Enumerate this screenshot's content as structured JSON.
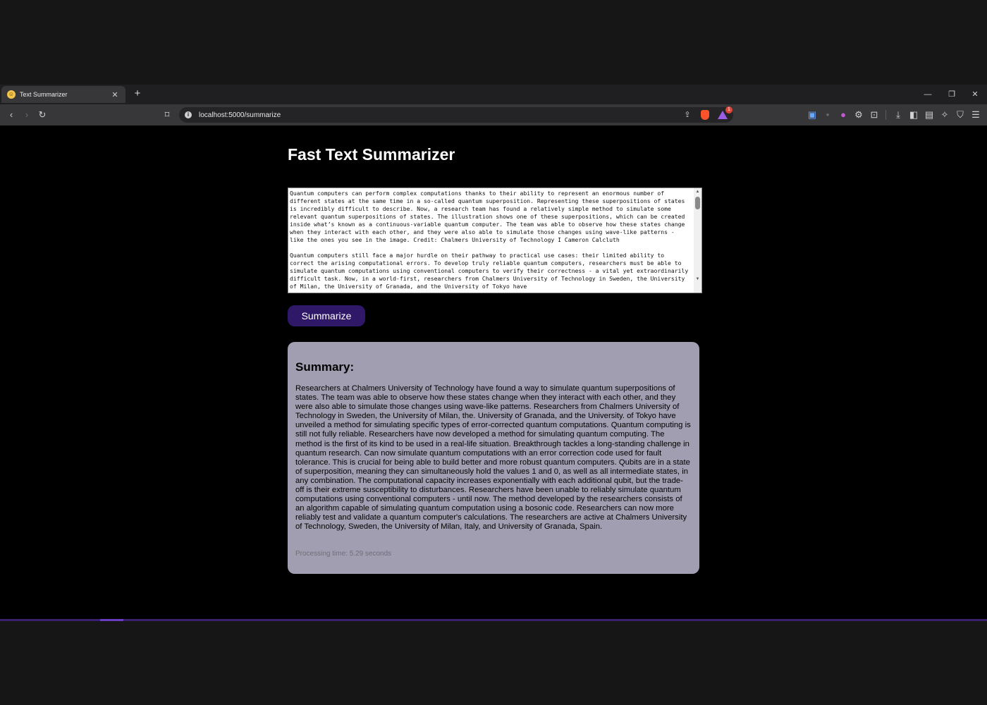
{
  "browser": {
    "tab": {
      "title": "Text Summarizer",
      "close": "✕"
    },
    "new_tab": "+",
    "window_controls": [
      "—",
      "❐",
      "✕"
    ],
    "url": "localhost:5000/summarize",
    "rewards_badge": "1"
  },
  "page": {
    "title": "Fast Text Summarizer",
    "input_text": "Quantum computers can perform complex computations thanks to their ability to represent an enormous number of different states at the same time in a so-called quantum superposition. Representing these superpositions of states is incredibly difficult to describe. Now, a research team has found a relatively simple method to simulate some relevant quantum superpositions of states. The illustration shows one of these superpositions, which can be created inside what’s known as a continuous-variable quantum computer. The team was able to observe how these states change when they interact with each other, and they were also able to simulate those changes using wave-like patterns - like the ones you see in the image. Credit: Chalmers University of Technology I Cameron Calcluth\n\nQuantum computers still face a major hurdle on their pathway to practical use cases: their limited ability to correct the arising computational errors. To develop truly reliable quantum computers, researchers must be able to simulate quantum computations using conventional computers to verify their correctness - a vital yet extraordinarily difficult task. Now, in a world-first, researchers from Chalmers University of Technology in Sweden, the University of Milan, the University of Granada, and the University of Tokyo have",
    "summarize_button": "Summarize",
    "summary": {
      "heading": "Summary:",
      "text": "Researchers at Chalmers University of Technology have found a way to simulate quantum superpositions of states. The team was able to observe how these states change when they interact with each other, and they were also able to simulate those changes using wave-like patterns. Researchers from Chalmers University of Technology in Sweden, the University of Milan, the. University of Granada, and the University. of Tokyo have unveiled a method for simulating specific types of error-corrected quantum computations. Quantum computing is still not fully reliable. Researchers have now developed a method for simulating quantum computing. The method is the first of its kind to be used in a real-life situation. Breakthrough tackles a long-standing challenge in quantum research. Can now simulate quantum computations with an error correction code used for fault tolerance. This is crucial for being able to build better and more robust quantum computers. Qubits are in a state of superposition, meaning they can simultaneously hold the values 1 and 0, as well as all intermediate states, in any combination. The computational capacity increases exponentially with each additional qubit, but the trade-off is their extreme susceptibility to disturbances. Researchers have been unable to reliably simulate quantum computations using conventional computers - until now. The method developed by the researchers consists of an algorithm capable of simulating quantum computation using a bosonic code. Researchers can now more reliably test and validate a quantum computer's calculations. The researchers are active at Chalmers University of Technology, Sweden, the University of Milan, Italy, and University of Granada, Spain.",
      "processing_time": "Processing time: 5.29 seconds"
    }
  },
  "colors": {
    "page_bg": "#000000",
    "button_bg": "#2f1868",
    "summary_bg": "#a09eb0",
    "chrome_dark": "#1f1f21",
    "toolbar": "#37373a"
  }
}
